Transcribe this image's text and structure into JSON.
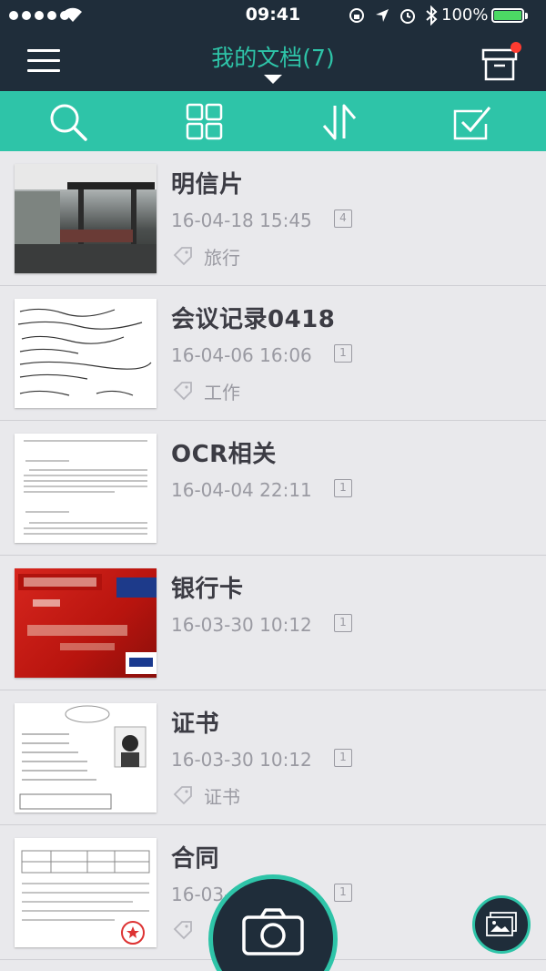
{
  "status_bar": {
    "time": "09:41",
    "battery_percent": "100%"
  },
  "nav": {
    "title": "我的文档(7)",
    "title_color": "#2ec4a8",
    "background_color": "#1f2d3a",
    "has_notification": true
  },
  "toolbar": {
    "background_color": "#2ec4a8",
    "icons": [
      "search-icon",
      "grid-view-icon",
      "sort-icon",
      "select-icon"
    ]
  },
  "documents": [
    {
      "title": "明信片",
      "date": "16-04-18 15:45",
      "pages": "4",
      "tag": "旅行",
      "thumbnail": "photo"
    },
    {
      "title": "会议记录0418",
      "date": "16-04-06 16:06",
      "pages": "1",
      "tag": "工作",
      "thumbnail": "handwriting"
    },
    {
      "title": "OCR相关",
      "date": "16-04-04 22:11",
      "pages": "1",
      "tag": "",
      "thumbnail": "text-document"
    },
    {
      "title": "银行卡",
      "date": "16-03-30 10:12",
      "pages": "1",
      "tag": "",
      "thumbnail": "bank-card"
    },
    {
      "title": "证书",
      "date": "16-03-30 10:12",
      "pages": "1",
      "tag": "证书",
      "thumbnail": "certificate"
    },
    {
      "title": "合同",
      "date": "16-03-",
      "pages": "1",
      "tag": "",
      "thumbnail": "contract"
    }
  ],
  "fab": {
    "camera": "camera-icon",
    "gallery": "gallery-icon"
  }
}
